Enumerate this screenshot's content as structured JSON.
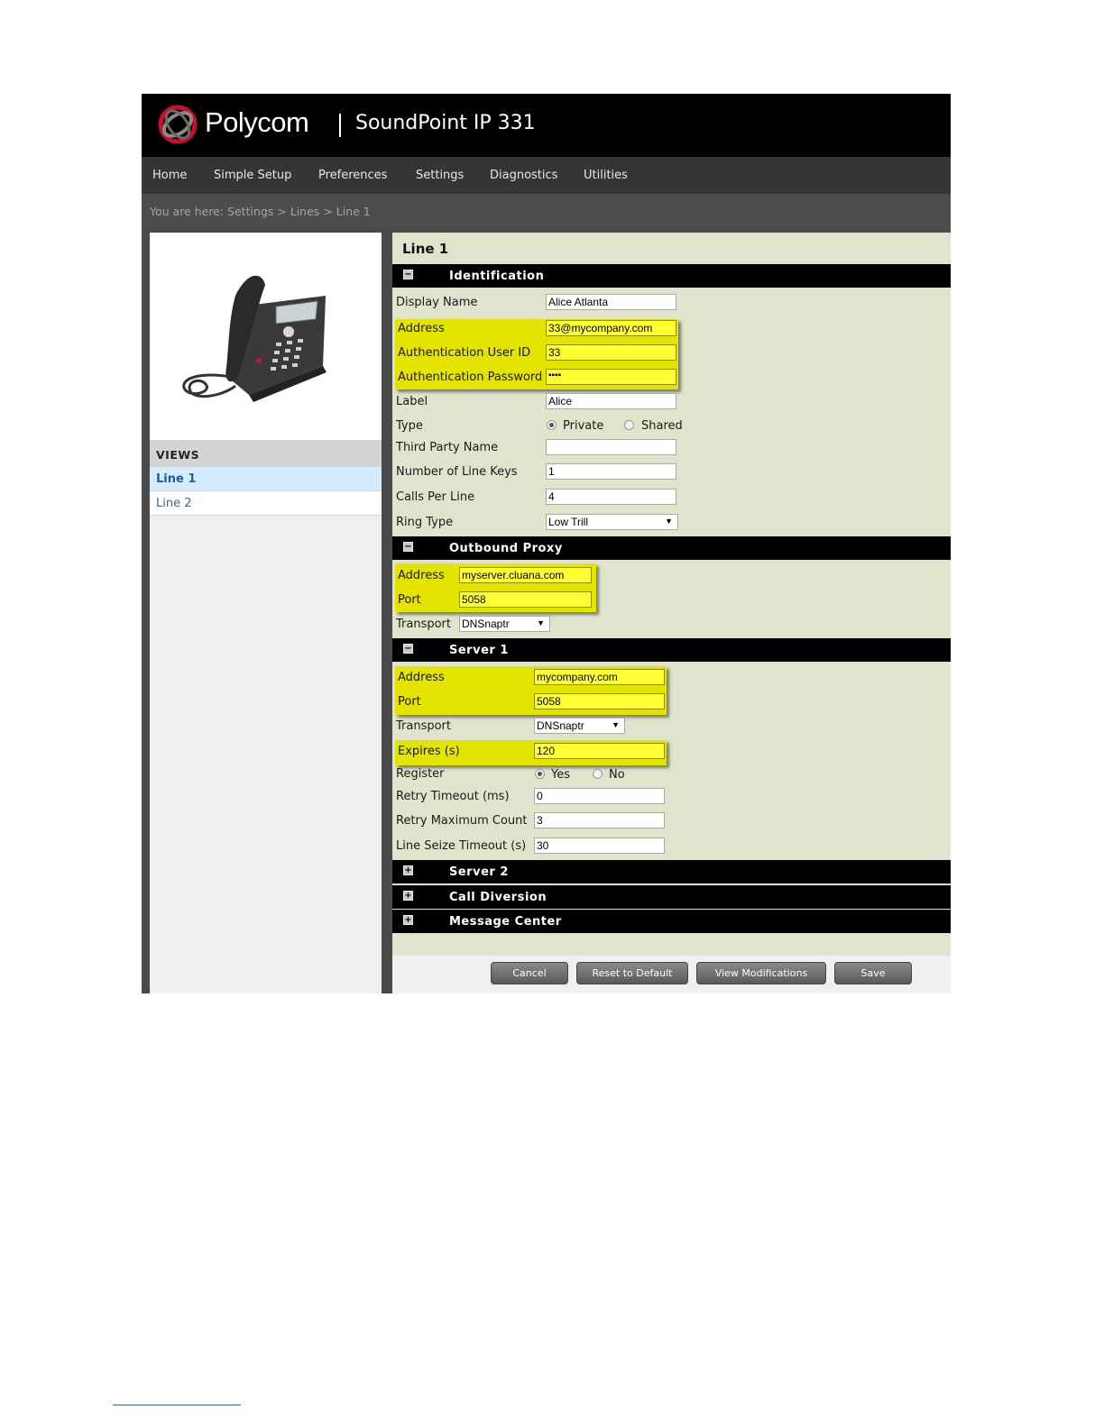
{
  "brand": {
    "logo_text": "Polycom",
    "product": "SoundPoint IP 331",
    "logo_color": "#c8102e"
  },
  "nav": [
    "Home",
    "Simple Setup",
    "Preferences",
    "Settings",
    "Diagnostics",
    "Utilities"
  ],
  "breadcrumb": "You are here: Settings > Lines > Line 1",
  "sidebar": {
    "views_title": "VIEWS",
    "items": [
      {
        "label": "Line 1",
        "selected": true
      },
      {
        "label": "Line 2",
        "selected": false
      }
    ]
  },
  "page_title": "Line 1",
  "sections": {
    "identification": {
      "title": "Identification",
      "toggle": "−",
      "display_name": {
        "label": "Display Name",
        "value": "Alice Atlanta"
      },
      "address": {
        "label": "Address",
        "value": "33@mycompany.com"
      },
      "auth_user_id": {
        "label": "Authentication User ID",
        "value": "33"
      },
      "auth_password": {
        "label": "Authentication Password",
        "value": "▪▪▪▪"
      },
      "line_label": {
        "label": "Label",
        "value": "Alice"
      },
      "type": {
        "label": "Type",
        "option_private": "Private",
        "option_shared": "Shared",
        "selected": "Private"
      },
      "third_party_name": {
        "label": "Third Party Name",
        "value": ""
      },
      "line_keys": {
        "label": "Number of Line Keys",
        "value": "1"
      },
      "calls_per_line": {
        "label": "Calls Per Line",
        "value": "4"
      },
      "ring_type": {
        "label": "Ring Type",
        "value": "Low Trill"
      }
    },
    "outbound_proxy": {
      "title": "Outbound Proxy",
      "toggle": "−",
      "address": {
        "label": "Address",
        "value": "myserver.cluana.com"
      },
      "port": {
        "label": "Port",
        "value": "5058"
      },
      "transport": {
        "label": "Transport",
        "value": "DNSnaptr"
      }
    },
    "server1": {
      "title": "Server 1",
      "toggle": "−",
      "address": {
        "label": "Address",
        "value": "mycompany.com"
      },
      "port": {
        "label": "Port",
        "value": "5058"
      },
      "transport": {
        "label": "Transport",
        "value": "DNSnaptr"
      },
      "expires": {
        "label": "Expires (s)",
        "value": "120"
      },
      "register": {
        "label": "Register",
        "option_yes": "Yes",
        "option_no": "No",
        "selected": "Yes"
      },
      "retry_timeout": {
        "label": "Retry Timeout (ms)",
        "value": "0"
      },
      "retry_max": {
        "label": "Retry Maximum Count",
        "value": "3"
      },
      "line_seize": {
        "label": "Line Seize Timeout (s)",
        "value": "30"
      }
    },
    "server2": {
      "title": "Server 2",
      "toggle": "+"
    },
    "call_diversion": {
      "title": "Call Diversion",
      "toggle": "+"
    },
    "message_center": {
      "title": "Message Center",
      "toggle": "+"
    }
  },
  "buttons": {
    "cancel": "Cancel",
    "reset": "Reset to Default",
    "view_mods": "View Modifications",
    "save": "Save"
  },
  "colors": {
    "highlight": "#e4e400",
    "panel_bg": "#dfe5cc",
    "link": "#2b6ea8"
  }
}
